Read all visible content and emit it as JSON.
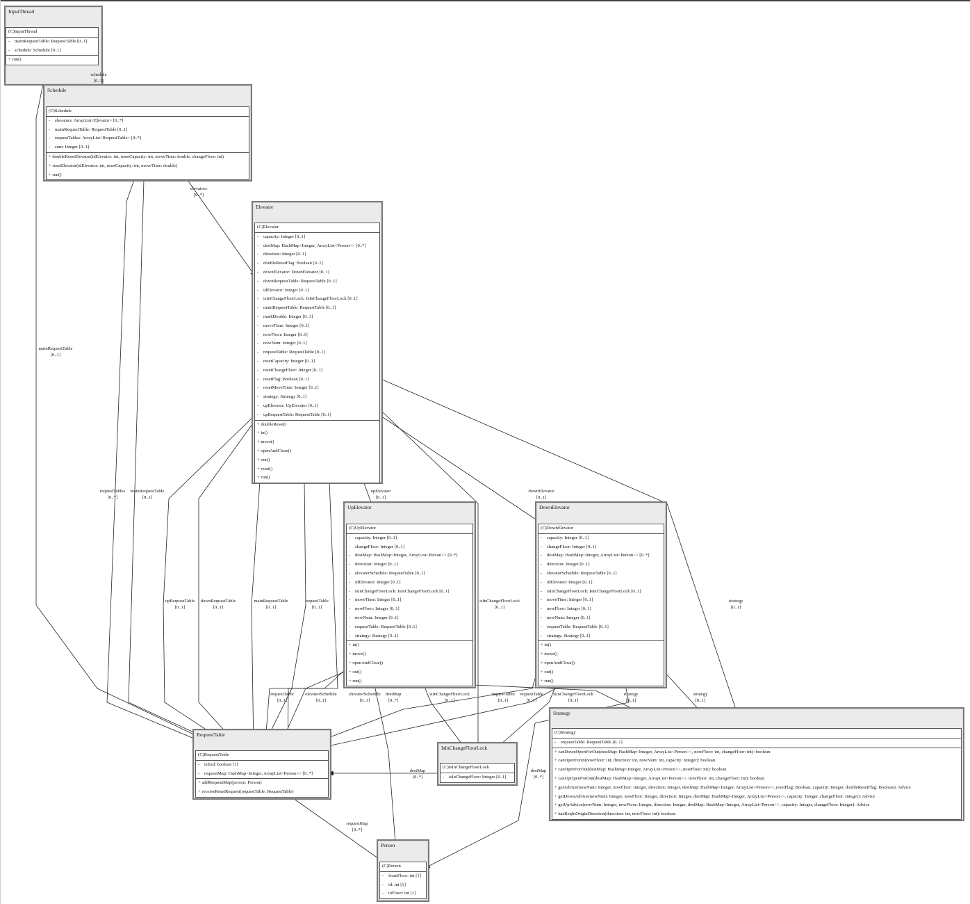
{
  "packages": {
    "InputThread": {
      "title": "InputThread",
      "class_name": "(C)InputThread",
      "attributes": [
        "mainRequestTable: RequestTable [0..1]",
        "schedule: Schedule [0..1]"
      ],
      "operations": [
        "run()"
      ]
    },
    "Schedule": {
      "title": "Schedule",
      "class_name": "(C)Schedule",
      "attributes": [
        "elevators: ArrayList<Elevator> [0..*]",
        "mainRequestTable: RequestTable [0..1]",
        "requestTables: ArrayList<RequestTable> [0..*]",
        "sum: Integer [0..1]"
      ],
      "operations": [
        "doubleResetElevator(idElevator: int, resetCapacity: int, moveTime: double, changeFloor: int)",
        "resetElevator(idElevator: int, resetCapacity: int, moveTime: double)",
        "run()"
      ]
    },
    "Elevator": {
      "title": "Elevator",
      "class_name": "(C)Elevator",
      "attributes": [
        "capacity: Integer [0..1]",
        "destMap: HashMap<Integer, ArrayList<Person>> [0..*]",
        "direction: Integer [0..1]",
        "doubleResetFlag: Boolean [0..1]",
        "downElevator: DownElevator [0..1]",
        "downRequestTable: RequestTable [0..1]",
        "idElevator: Integer [0..1]",
        "isInChangeFloorLock: IsInChangeFloorLock [0..1]",
        "mainRequestTable: RequestTable [0..1]",
        "markDouble: Integer [0..1]",
        "moveTime: Integer [0..1]",
        "nowFloor: Integer [0..1]",
        "nowNum: Integer [0..1]",
        "requestTable: RequestTable [0..1]",
        "resetCapacity: Integer [0..1]",
        "resetChangeFloor: Integer [0..1]",
        "resetFlag: Boolean [0..1]",
        "resetMoveTime: Integer [0..1]",
        "strategy: Strategy [0..1]",
        "upElevator: UpElevator [0..1]",
        "upRequestTable: RequestTable [0..1]"
      ],
      "operations": [
        "doubleReset()",
        "in()",
        "move()",
        "openAndClose()",
        "out()",
        "reset()",
        "run()"
      ]
    },
    "UpElevator": {
      "title": "UpElevator",
      "class_name": "(C)UpElevator",
      "attributes": [
        "capacity: Integer [0..1]",
        "changeFloor: Integer [0..1]",
        "destMap: HashMap<Integer, ArrayList<Person>> [0..*]",
        "direction: Integer [0..1]",
        "elevatorSchedule: RequestTable [0..1]",
        "idElevator: Integer [0..1]",
        "isInChangeFloorLock: IsInChangeFloorLock [0..1]",
        "moveTime: Integer [0..1]",
        "nowFloor: Integer [0..1]",
        "nowNum: Integer [0..1]",
        "requestTable: RequestTable [0..1]",
        "strategy: Strategy [0..1]"
      ],
      "operations": [
        "in()",
        "move()",
        "openAndClose()",
        "out()",
        "run()"
      ]
    },
    "DownElevator": {
      "title": "DownElevator",
      "class_name": "(C)DownElevator",
      "attributes": [
        "capacity: Integer [0..1]",
        "changeFloor: Integer [0..1]",
        "destMap: HashMap<Integer, ArrayList<Person>> [0..*]",
        "direction: Integer [0..1]",
        "elevatorSchedule: RequestTable [0..1]",
        "idElevator: Integer [0..1]",
        "isInChangeFloorLock: IsInChangeFloorLock [0..1]",
        "moveTime: Integer [0..1]",
        "nowFloor: Integer [0..1]",
        "nowNum: Integer [0..1]",
        "requestTable: RequestTable [0..1]",
        "strategy: Strategy [0..1]"
      ],
      "operations": [
        "in()",
        "move()",
        "openAndClose()",
        "out()",
        "run()"
      ]
    },
    "Strategy": {
      "title": "Strategy",
      "class_name": "(C)Strategy",
      "attributes": [
        "requestTable: RequestTable [0..1]"
      ],
      "operations": [
        "canDownOpenForOut(destMap: HashMap<Integer, ArrayList<Person>>, nowFloor: int, changeFloor: int): boolean",
        "canOpenForIn(nowFloor: int, direction: int, nowNum: int, capacity: Integer): boolean",
        "canOpenForOut(destMap: HashMap<Integer, ArrayList<Person>>, nowFloor: int): boolean",
        "canUpOpenForOut(destMap: HashMap<Integer, ArrayList<Person>>, nowFloor: int, changeFloor: int): boolean",
        "getAdvice(nowNum: Integer, nowFloor: Integer, direction: Integer, destMap: HashMap<Integer, ArrayList<Person>>, resetFlag: Boolean, capacity: Integer, doubleResetFlag: Boolean): Advice",
        "getDownAdvice(nowNum: Integer, nowFloor: Integer, direction: Integer, destMap: HashMap<Integer, ArrayList<Person>>, capacity: Integer, changeFloor: Integer): Advice",
        "getUpAdvice(nowNum: Integer, nowFloor: Integer, direction: Integer, destMap: HashMap<Integer, ArrayList<Person>>, capacity: Integer, changeFloor: Integer): Advice",
        "hasReqInOriginDirection(direction: int, nowFloor: int): boolean"
      ]
    },
    "RequestTable": {
      "title": "RequestTable",
      "class_name": "(C)RequestTable",
      "attributes": [
        "isEnd: boolean [1]",
        "requestMap: HashMap<Integer, ArrayList<Person>> [0..*]"
      ],
      "operations": [
        "addRequestMap(person: Person)",
        "receiveResetRequest(requestTable: RequestTable)"
      ]
    },
    "IsInChangeFloorLock": {
      "title": "IsInChangeFloorLock",
      "class_name": "(C)IsInChangeFloorLock",
      "attributes": [
        "isInChangeFloor: Integer [0..1]"
      ],
      "operations": []
    },
    "Person": {
      "title": "Person",
      "class_name": "(C)Person",
      "attributes": [
        "fromFloor: int [1]",
        "id: int [1]",
        "toFloor: int [1]"
      ],
      "operations": []
    }
  },
  "edges": [
    {
      "role": "schedule",
      "mult": "[0..1]"
    },
    {
      "role": "elevators",
      "mult": "[0..*]"
    },
    {
      "role": "mainRequestTable",
      "mult": "[0..1]"
    },
    {
      "role": "requestTables",
      "mult": "[0..*]"
    },
    {
      "role": "mainRequestTable",
      "mult": "[0..1]"
    },
    {
      "role": "upElevator",
      "mult": "[0..1]"
    },
    {
      "role": "downElevator",
      "mult": "[0..1]"
    },
    {
      "role": "upRequestTable",
      "mult": "[0..1]"
    },
    {
      "role": "downRequestTable",
      "mult": "[0..1]"
    },
    {
      "role": "mainRequestTable",
      "mult": "[0..1]"
    },
    {
      "role": "requestTable",
      "mult": "[0..1]"
    },
    {
      "role": "isInChangeFloorLock",
      "mult": "[0..1]"
    },
    {
      "role": "strategy",
      "mult": "[0..1]"
    },
    {
      "role": "requestTable",
      "mult": "[0..1]"
    },
    {
      "role": "elevatorSchedule",
      "mult": "[0..1]"
    },
    {
      "role": "elevatorSchedule",
      "mult": "[0..1]"
    },
    {
      "role": "destMap",
      "mult": "[0..*]"
    },
    {
      "role": "isInChangeFloorLock",
      "mult": "[0..1]"
    },
    {
      "role": "requestTable",
      "mult": "[0..1]"
    },
    {
      "role": "requestTable",
      "mult": "[0..1]"
    },
    {
      "role": "isInChangeFloorLock",
      "mult": "[0..1]"
    },
    {
      "role": "strategy",
      "mult": "[0..1]"
    },
    {
      "role": "strategy",
      "mult": "[0..1]"
    },
    {
      "role": "destMap",
      "mult": "[0..*]"
    },
    {
      "role": "destMap",
      "mult": "[0..*]"
    },
    {
      "role": "requestMap",
      "mult": "[0..*]"
    }
  ]
}
